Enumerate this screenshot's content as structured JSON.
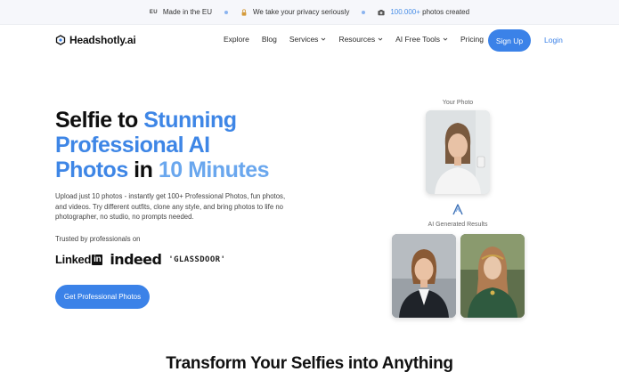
{
  "topbar": {
    "eu_tag": "EU",
    "made_in": "Made in the EU",
    "privacy": "We take your privacy seriously",
    "photos_count": "100.000+",
    "photos_suffix": " photos created"
  },
  "nav": {
    "logo": "Headshotly.ai",
    "items": [
      {
        "label": "Explore",
        "dropdown": false
      },
      {
        "label": "Blog",
        "dropdown": false
      },
      {
        "label": "Services",
        "dropdown": true
      },
      {
        "label": "Resources",
        "dropdown": true
      },
      {
        "label": "AI Free Tools",
        "dropdown": true
      },
      {
        "label": "Pricing",
        "dropdown": false
      }
    ],
    "signup": "Sign Up",
    "login": "Login"
  },
  "hero": {
    "title_part1": "Selfie to ",
    "title_part2": "Stunning",
    "title_part3": "Professional AI",
    "title_part4": "Photos",
    "title_part5": " in ",
    "title_part6": "10 Minutes",
    "description": "Upload just 10 photos - instantly get 100+ Professional Photos, fun photos, and videos. Try different outfits, clone any style, and bring photos to life no photographer, no studio, no prompts needed.",
    "trusted": "Trusted by professionals on",
    "logo_linkedin_text": "Linked",
    "logo_linkedin_box": "in",
    "logo_indeed": "indeed",
    "logo_glassdoor": "'GLASSDOOR'",
    "cta": "Get Professional Photos"
  },
  "visual": {
    "your_photo_label": "Your Photo",
    "ai_results_label": "AI Generated Results"
  },
  "section": {
    "title": "Transform Your Selfies into Anything"
  },
  "colors": {
    "accent": "#3b82e8",
    "accent_light": "#6aa7ee"
  }
}
